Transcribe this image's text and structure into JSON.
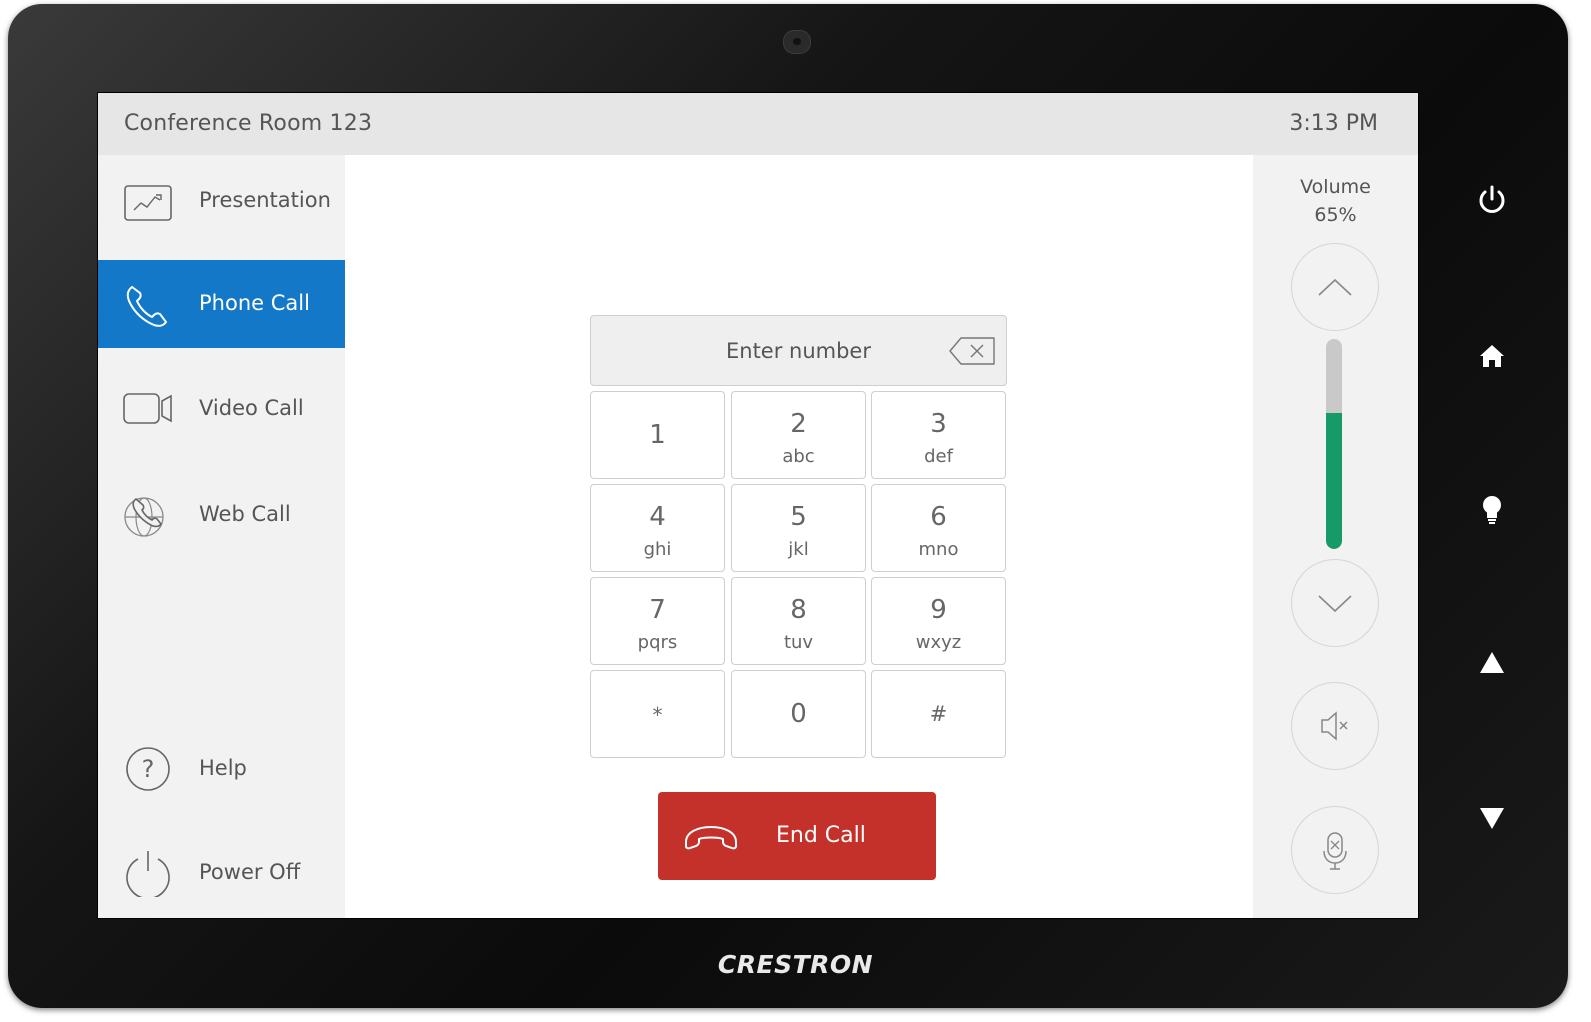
{
  "header": {
    "room_name": "Conference Room 123",
    "time": "3:13 PM"
  },
  "sidebar": {
    "items": [
      {
        "label": "Presentation",
        "icon": "presentation-icon",
        "active": false
      },
      {
        "label": "Phone Call",
        "icon": "phone-icon",
        "active": true
      },
      {
        "label": "Video Call",
        "icon": "video-camera-icon",
        "active": false
      },
      {
        "label": "Web Call",
        "icon": "web-call-icon",
        "active": false
      }
    ],
    "bottom": [
      {
        "label": "Help",
        "icon": "help-icon"
      },
      {
        "label": "Power Off",
        "icon": "power-icon"
      }
    ]
  },
  "dialer": {
    "placeholder": "Enter number",
    "keys": [
      {
        "digit": "1",
        "letters": ""
      },
      {
        "digit": "2",
        "letters": "abc"
      },
      {
        "digit": "3",
        "letters": "def"
      },
      {
        "digit": "4",
        "letters": "ghi"
      },
      {
        "digit": "5",
        "letters": "jkl"
      },
      {
        "digit": "6",
        "letters": "mno"
      },
      {
        "digit": "7",
        "letters": "pqrs"
      },
      {
        "digit": "8",
        "letters": "tuv"
      },
      {
        "digit": "9",
        "letters": "wxyz"
      },
      {
        "digit": "*",
        "letters": ""
      },
      {
        "digit": "0",
        "letters": ""
      },
      {
        "digit": "#",
        "letters": ""
      }
    ],
    "end_call_label": "End Call"
  },
  "volume": {
    "title": "Volume",
    "percent_text": "65%",
    "level": 0.65
  },
  "hardware_buttons": [
    "power-icon",
    "home-icon",
    "lightbulb-icon",
    "up-arrow-icon",
    "down-arrow-icon"
  ],
  "brand": "CRESTRON",
  "colors": {
    "accent": "#1378c8",
    "end_call": "#c4312a",
    "volume_fill": "#169b68"
  }
}
